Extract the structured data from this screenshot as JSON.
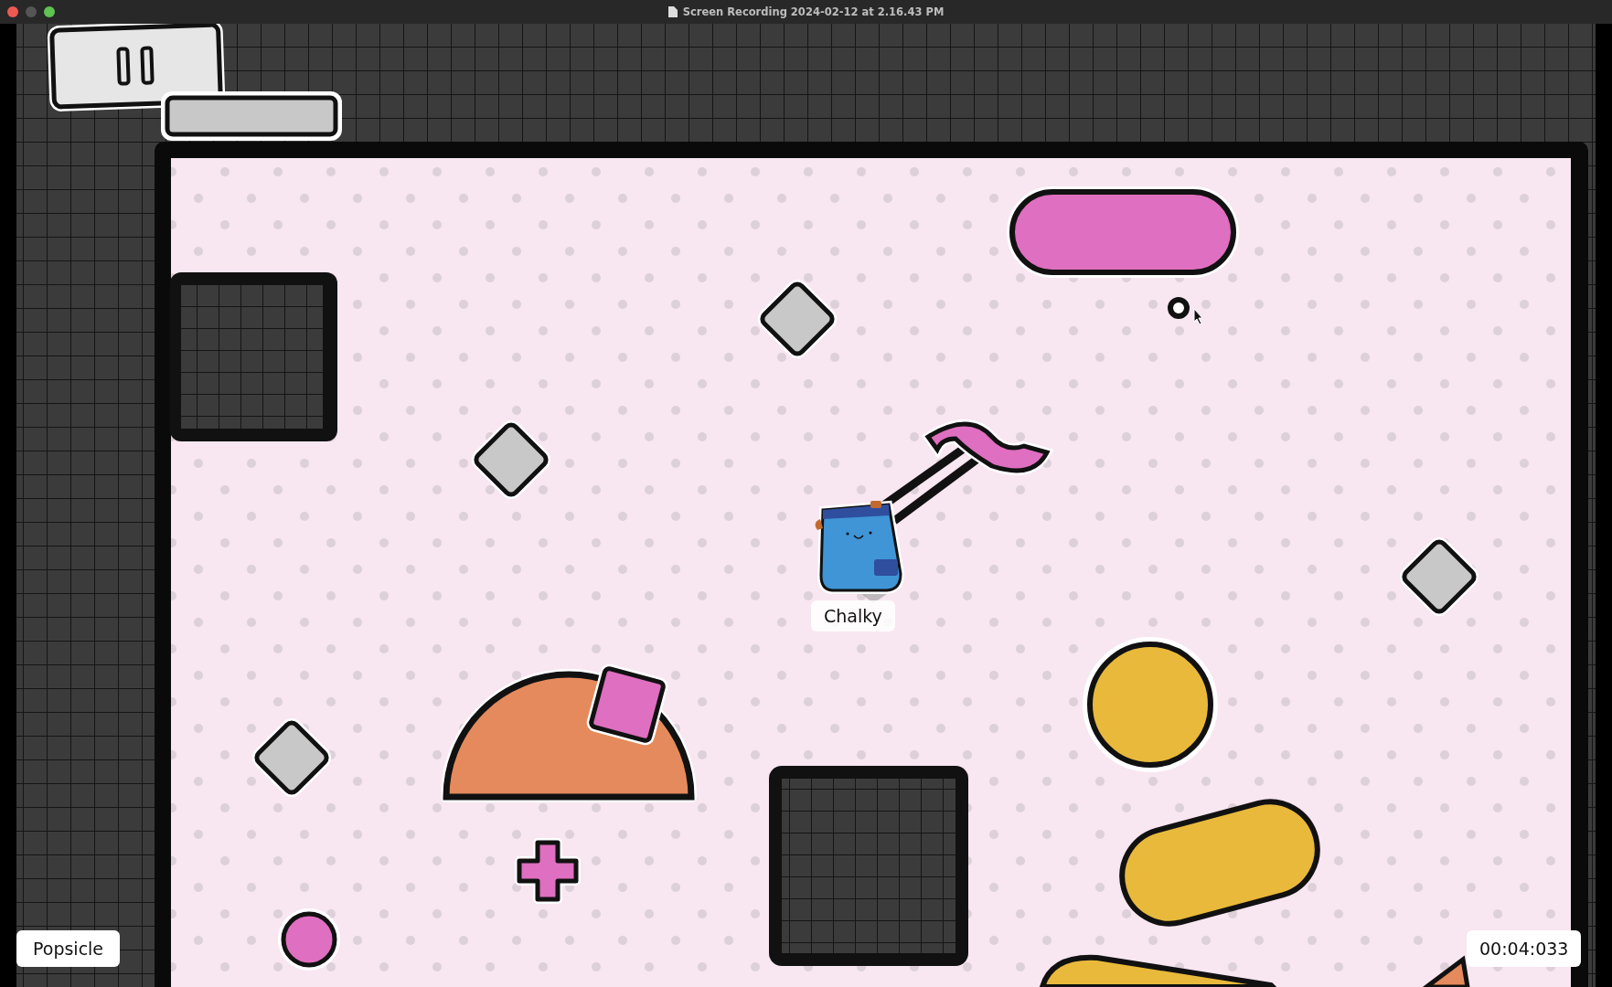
{
  "window": {
    "title": "Screen Recording 2024-02-12 at 2.16.43 PM"
  },
  "player_tag": "Chalky",
  "bottom_left_label": "Popsicle",
  "timer": "00:04:033"
}
